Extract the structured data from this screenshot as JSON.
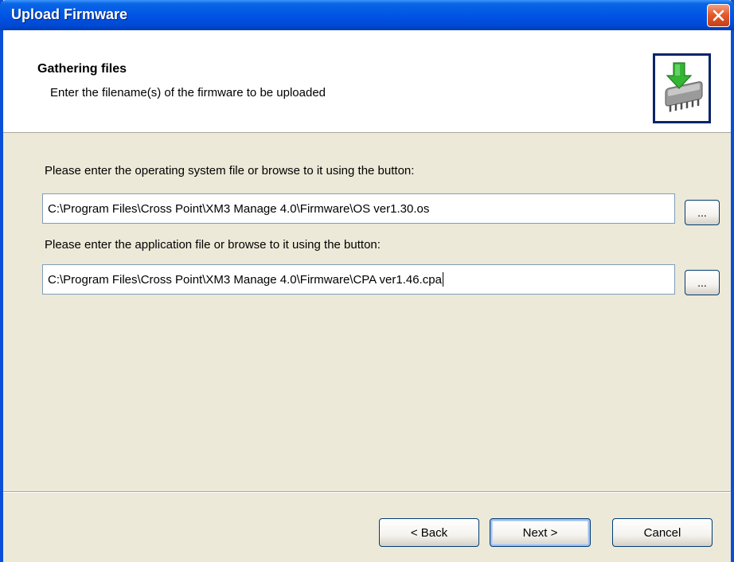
{
  "window": {
    "title": "Upload Firmware"
  },
  "header": {
    "title": "Gathering files",
    "subtitle": "Enter the filename(s) of the firmware to be uploaded",
    "icon": "firmware-chip-download-icon"
  },
  "os_file": {
    "label": "Please enter the operating system file or browse to it using the button:",
    "value": "C:\\Program Files\\Cross Point\\XM3 Manage 4.0\\Firmware\\OS ver1.30.os",
    "browse_label": "..."
  },
  "app_file": {
    "label": "Please enter the application file or browse to it using the button:",
    "value": "C:\\Program Files\\Cross Point\\XM3 Manage 4.0\\Firmware\\CPA ver1.46.cpa",
    "browse_label": "..."
  },
  "buttons": {
    "back": "< Back",
    "next": "Next >",
    "cancel": "Cancel"
  },
  "colors": {
    "title_bar": "#0055E5",
    "dialog_face": "#ECE9D8",
    "close_button": "#E55A2B"
  }
}
